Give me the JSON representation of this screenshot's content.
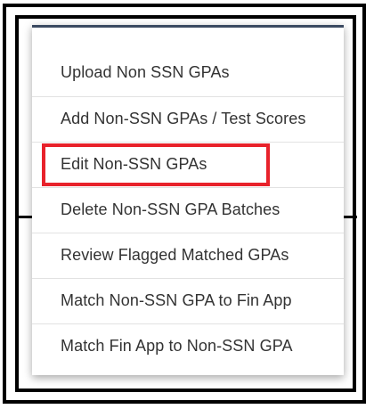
{
  "menu": {
    "items": [
      {
        "label": "Upload Non SSN GPAs",
        "highlighted": false
      },
      {
        "label": "Add Non-SSN GPAs / Test Scores",
        "highlighted": false
      },
      {
        "label": "Edit Non-SSN GPAs",
        "highlighted": true
      },
      {
        "label": "Delete Non-SSN GPA Batches",
        "highlighted": false
      },
      {
        "label": "Review Flagged Matched GPAs",
        "highlighted": false
      },
      {
        "label": "Match Non-SSN GPA to Fin App",
        "highlighted": false
      },
      {
        "label": "Match Fin App to Non-SSN GPA",
        "highlighted": false
      }
    ]
  },
  "colors": {
    "accent_border": "#3b4a61",
    "highlight": "#e8222b",
    "text": "#333333",
    "frame": "#000000"
  }
}
